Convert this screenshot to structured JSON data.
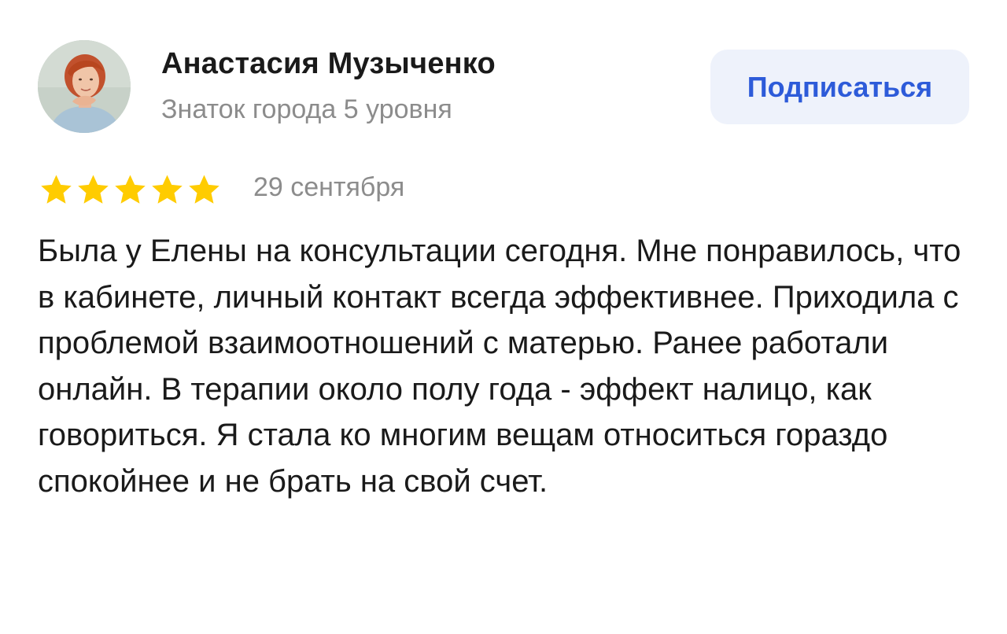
{
  "author": {
    "name": "Анастасия Музыченко",
    "level": "Знаток города 5 уровня",
    "avatar_icon": "user-avatar-photo"
  },
  "subscribe": {
    "label": "Подписаться"
  },
  "review": {
    "rating": 5,
    "rating_max": 5,
    "date": "29 сентября",
    "text": "Была у Елены на консультации сегодня. Мне понравилось, что в кабинете, личный контакт всегда эффективнее. Приходила с проблемой взаимоотношений с матерью. Ранее работали онлайн. В терапии около полу года - эффект налицо, как говориться. Я стала ко многим вещам относиться гораздо спокойнее и не брать на свой счет."
  },
  "colors": {
    "star": "#FFCC00",
    "accent": "#2D5BD9",
    "button_bg": "#EEF2FB",
    "secondary_text": "#8C8C8C",
    "primary_text": "#1A1A1A"
  }
}
